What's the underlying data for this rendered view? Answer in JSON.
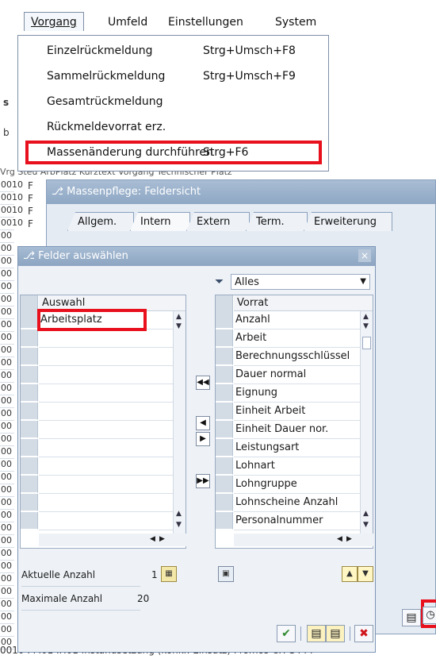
{
  "menubar": {
    "items": [
      {
        "label": "Vorgang",
        "active": true
      },
      {
        "label": "Umfeld"
      },
      {
        "label": "Einstellungen"
      },
      {
        "label": "System"
      }
    ]
  },
  "dropdown": {
    "items": [
      {
        "label": "Einzelrückmeldung",
        "shortcut": "Strg+Umsch+F8"
      },
      {
        "label": "Sammelrückmeldung",
        "shortcut": "Strg+Umsch+F9"
      },
      {
        "label": "Gesamtrückmeldung",
        "shortcut": ""
      },
      {
        "label": "Rückmeldevorrat erz.",
        "shortcut": ""
      },
      {
        "label": "Massenänderung durchführen",
        "shortcut": "Strg+F6",
        "highlighted": true
      }
    ]
  },
  "background": {
    "header_text": "Vrg   Steu   ArbPlatz  Kurztext Vorgang                                    Technischer Platz",
    "left_codes": [
      "0010",
      "0010",
      "0010",
      "0010",
      "00",
      "00",
      "00",
      "00",
      "00",
      "00",
      "00",
      "00",
      "00",
      "00",
      "00",
      "00",
      "00",
      "00",
      "00",
      "00",
      "00",
      "00",
      "00",
      "00",
      "00",
      "00",
      "00",
      "00",
      "00",
      "00",
      "00",
      "00",
      "00",
      "00",
      "00",
      "00",
      "00"
    ],
    "footer_row": "0010  PM01  IH01      Instandsetzung (konkr. Einsatz) Promos      CH-S444",
    "side_letters": [
      "F",
      "F",
      "F",
      "F"
    ],
    "fragments": {
      "s_char": "s",
      "b_char": "b"
    }
  },
  "dialog1": {
    "title": "Massenpflege: Feldersicht",
    "tabs": [
      "Allgem.",
      "Intern",
      "Extern",
      "Term.",
      "Erweiterung"
    ],
    "active_tab": "Intern"
  },
  "dialog2": {
    "title": "Felder auswählen",
    "close_symbol": "×",
    "filter": {
      "icon": "filter-icon",
      "value": "Alles"
    },
    "left_list": {
      "header": "Auswahl",
      "rows": [
        "Arbeitsplatz"
      ]
    },
    "right_list": {
      "header": "Vorrat",
      "rows": [
        "Anzahl",
        "Arbeit",
        "Berechnungsschlüssel",
        "Dauer normal",
        "Eignung",
        "Einheit Arbeit",
        "Einheit Dauer nor.",
        "Leistungsart",
        "Lohnart",
        "Lohngruppe",
        "Lohnscheine Anzahl",
        "Personalnummer"
      ]
    },
    "stats": {
      "current_label": "Aktuelle Anzahl",
      "current_value": "1",
      "max_label": "Maximale Anzahl",
      "max_value": "20"
    }
  },
  "colors": {
    "highlight_red": "#e8101c",
    "title_blue": "#9fb4cd",
    "dialog_bg": "#eef2f7"
  }
}
